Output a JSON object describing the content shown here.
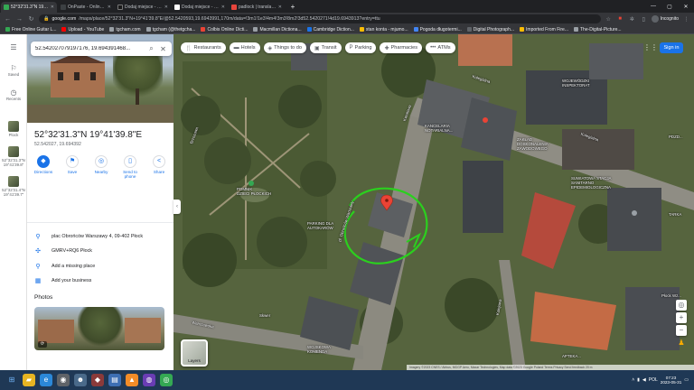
{
  "browser": {
    "tabs": [
      {
        "label": "52°32'31.3\"N 19°41'39.8\"E - Goo",
        "color": "#34a853",
        "active": true
      },
      {
        "label": "OnPaste - Online Screenshot and",
        "color": "#3c4043",
        "active": false
      },
      {
        "label": "Dodaj miejsce - Desolate Zone",
        "color": "#1a1a1a",
        "active": false
      },
      {
        "label": "Dodaj miejsce - Urbexy.pl - gdzie",
        "color": "#ffffff",
        "active": false
      },
      {
        "label": "padlock | translate English to Pol",
        "color": "#e8453c",
        "active": false
      }
    ],
    "url_host": "google.com",
    "url_rest": "/maps/place/52°32'31.3\"N+19°41'39.8\"E/@52.5420593,19.6943991,170m/data=!3m1!1e3!4m4!3m3!8m2!3d52.5420271!4d19.6943913?entry=ttu",
    "incognito_label": "Incognito",
    "window_controls": [
      "—",
      "▢",
      "✕"
    ]
  },
  "bookmarks": [
    {
      "label": "Free Online Guitar L...",
      "color": "#34a853"
    },
    {
      "label": "Upload - YouTube",
      "color": "#ff0000"
    },
    {
      "label": "tgcham.com",
      "color": "#9aa0a6"
    },
    {
      "label": "tgcham (@thetgcha...",
      "color": "#9aa0a6"
    },
    {
      "label": "Colbis Online Dicti...",
      "color": "#ea4335"
    },
    {
      "label": "Macmillan Dictiona...",
      "color": "#9aa0a6"
    },
    {
      "label": "Cambridge Diction...",
      "color": "#1a73e8"
    },
    {
      "label": "stan konta - mjumo...",
      "color": "#fbbc04"
    },
    {
      "label": "Pogoda długotermi...",
      "color": "#4285f4"
    },
    {
      "label": "Digital Photograph...",
      "color": "#5f6368"
    },
    {
      "label": "Imported From Fire...",
      "color": "#fbbc04"
    },
    {
      "label": "The-Digital-Picture...",
      "color": "#9aa0a6"
    }
  ],
  "rail": {
    "saved_label": "Saved",
    "recents_label": "Recents",
    "recent_items": [
      "Plock",
      "52°32'31.3\"N 19°41'39.8\"",
      "52°32'31.4\"N 19°41'39.7\""
    ]
  },
  "panel": {
    "search_value": "52.542027079197176, 19.694391468...",
    "title": "52°32'31.3\"N 19°41'39.8\"E",
    "subtitle": "52.542027, 19.694392",
    "actions": [
      {
        "label": "Directions",
        "icon": "directions-icon",
        "glyph": "◆"
      },
      {
        "label": "Save",
        "icon": "bookmark-icon",
        "glyph": "⚑"
      },
      {
        "label": "Nearby",
        "icon": "nearby-icon",
        "glyph": "◎"
      },
      {
        "label": "Send to phone",
        "icon": "phone-icon",
        "glyph": "▯"
      },
      {
        "label": "Share",
        "icon": "share-icon",
        "glyph": "<"
      }
    ],
    "info": {
      "address": "plac Obrońców Warszawy 4, 09-402 Płock",
      "pluscode": "GMRV+RQ6 Płock",
      "missing_place": "Add a missing place",
      "business": "Add your business"
    },
    "photos_label": "Photos"
  },
  "map": {
    "chips": [
      {
        "label": "Restaurants",
        "glyph": "🍴"
      },
      {
        "label": "Hotels",
        "glyph": "▬"
      },
      {
        "label": "Things to do",
        "glyph": "◈"
      },
      {
        "label": "Transit",
        "glyph": "▣"
      },
      {
        "label": "Parking",
        "glyph": "P"
      },
      {
        "label": "Pharmacies",
        "glyph": "✚"
      },
      {
        "label": "ATMs",
        "glyph": "•••"
      }
    ],
    "signin_label": "Sign in",
    "labels": {
      "kolegialna": "Kolegialna",
      "kolegialna2": "Kolegialna",
      "kancelaria": "KANCELARIA\nNOTARIALNA...",
      "wojewodzki": "WOJEWÓDZKI\nINSPEKTORAT",
      "zaklad": "ZAKŁAD\nDOSKONALENIA\nZAWODOWEGO",
      "pdzd": "PDZD...",
      "suwiatowa": "SUWIATOWA STACJA\nSANITARNO\nEPIDEMIOLOGICZNA",
      "tarka": "TARKA",
      "plock_wz": "Płock Wz...",
      "parking": "PARKING DLA\nAUTOKARÓW",
      "pomnik": "POMNIK\nDZIECI PŁOCKICH",
      "brzozowa": "Brzozowa",
      "kwiatowa": "Kwiatowa",
      "pl_obroncow": "pl. Obrońców Warszawy",
      "warszawska": "Warszawska",
      "wojskowa": "WOJSKOWA\nKOMENDA",
      "skwer": "Skwer",
      "apteka": "APTEKA...",
      "kolejowa": "Kolejowa"
    },
    "layers_label": "Layers",
    "attribution": "Imagery ©2023 CNES / Airbus, MGGP Aero, Maxar Technologies, Map data ©2023 Google   Poland   Terms   Privacy   Send feedback   20 m",
    "zoom_in": "+",
    "zoom_out": "−"
  },
  "taskbar": {
    "apps": [
      {
        "name": "start-icon",
        "glyph": "⊞",
        "color": "#1f3855"
      },
      {
        "name": "explorer-icon",
        "glyph": "▰",
        "color": "#e6b422"
      },
      {
        "name": "edge-icon",
        "glyph": "e",
        "color": "#2b88d8"
      },
      {
        "name": "gimp-icon",
        "glyph": "◉",
        "color": "#5f6368"
      },
      {
        "name": "alien-icon",
        "glyph": "☻",
        "color": "#4a6a8a"
      },
      {
        "name": "media-icon",
        "glyph": "◆",
        "color": "#8b3a3a"
      },
      {
        "name": "folder-icon",
        "glyph": "▤",
        "color": "#3d6fb4"
      },
      {
        "name": "vlc-icon",
        "glyph": "▲",
        "color": "#f28c28"
      },
      {
        "name": "paint-icon",
        "glyph": "◍",
        "color": "#6a3db4"
      },
      {
        "name": "chrome-icon",
        "glyph": "◎",
        "color": "#34a853"
      }
    ],
    "time": "07:23",
    "date": "2023-05-31",
    "lang": "POL"
  }
}
